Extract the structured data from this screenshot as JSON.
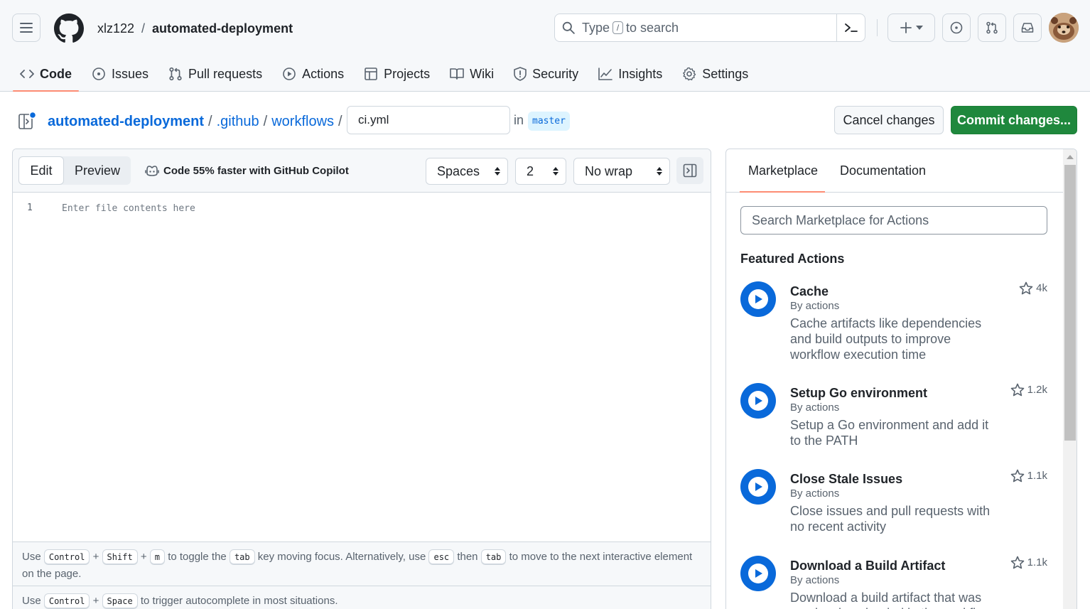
{
  "header": {
    "owner": "xlz122",
    "separator": "/",
    "repo": "automated-deployment",
    "search": {
      "before": "Type",
      "key": "/",
      "after": "to search"
    }
  },
  "nav": {
    "items": [
      {
        "label": "Code",
        "icon": "code-icon",
        "active": true
      },
      {
        "label": "Issues",
        "icon": "issue-icon"
      },
      {
        "label": "Pull requests",
        "icon": "pull-request-icon"
      },
      {
        "label": "Actions",
        "icon": "play-icon"
      },
      {
        "label": "Projects",
        "icon": "table-icon"
      },
      {
        "label": "Wiki",
        "icon": "book-icon"
      },
      {
        "label": "Security",
        "icon": "shield-icon"
      },
      {
        "label": "Insights",
        "icon": "graph-icon"
      },
      {
        "label": "Settings",
        "icon": "gear-icon"
      }
    ]
  },
  "breadcrumb": {
    "root": "automated-deployment",
    "sep": "/",
    "parts": [
      ".github",
      "workflows"
    ],
    "filename": "ci.yml",
    "in_label": "in",
    "branch": "master"
  },
  "buttons": {
    "cancel": "Cancel changes",
    "commit": "Commit changes..."
  },
  "editor": {
    "tabs": {
      "edit": "Edit",
      "preview": "Preview"
    },
    "copilot": "Code 55% faster with GitHub Copilot",
    "indent_mode": "Spaces",
    "indent_size": "2",
    "wrap_mode": "No wrap",
    "line_number": "1",
    "placeholder": "Enter file contents here",
    "footer": {
      "line1": {
        "use": "Use",
        "k1": "Control",
        "plus": "+",
        "k2": "Shift",
        "k3": "m",
        "t1": "to toggle the",
        "k4": "tab",
        "t2": "key moving focus. Alternatively, use",
        "k5": "esc",
        "t3": "then",
        "k6": "tab",
        "t4": "to move to the next interactive element on the page."
      },
      "line2": {
        "use": "Use",
        "k1": "Control",
        "plus": "+",
        "k2": "Space",
        "t1": "to trigger autocomplete in most situations."
      }
    }
  },
  "sidebar": {
    "tabs": [
      "Marketplace",
      "Documentation"
    ],
    "search_placeholder": "Search Marketplace for Actions",
    "featured_title": "Featured Actions",
    "actions": [
      {
        "title": "Cache",
        "by": "By actions",
        "desc": "Cache artifacts like dependencies and build outputs to improve workflow execution time",
        "stars": "4k"
      },
      {
        "title": "Setup Go environment",
        "by": "By actions",
        "desc": "Setup a Go environment and add it to the PATH",
        "stars": "1.2k"
      },
      {
        "title": "Close Stale Issues",
        "by": "By actions",
        "desc": "Close issues and pull requests with no recent activity",
        "stars": "1.1k"
      },
      {
        "title": "Download a Build Artifact",
        "by": "By actions",
        "desc": "Download a build artifact that was previously uploaded in the workflow",
        "stars": "1.1k"
      }
    ]
  },
  "colors": {
    "accent": "#0969da",
    "primary_button": "#1f883d",
    "tab_underline": "#fd8c73"
  }
}
